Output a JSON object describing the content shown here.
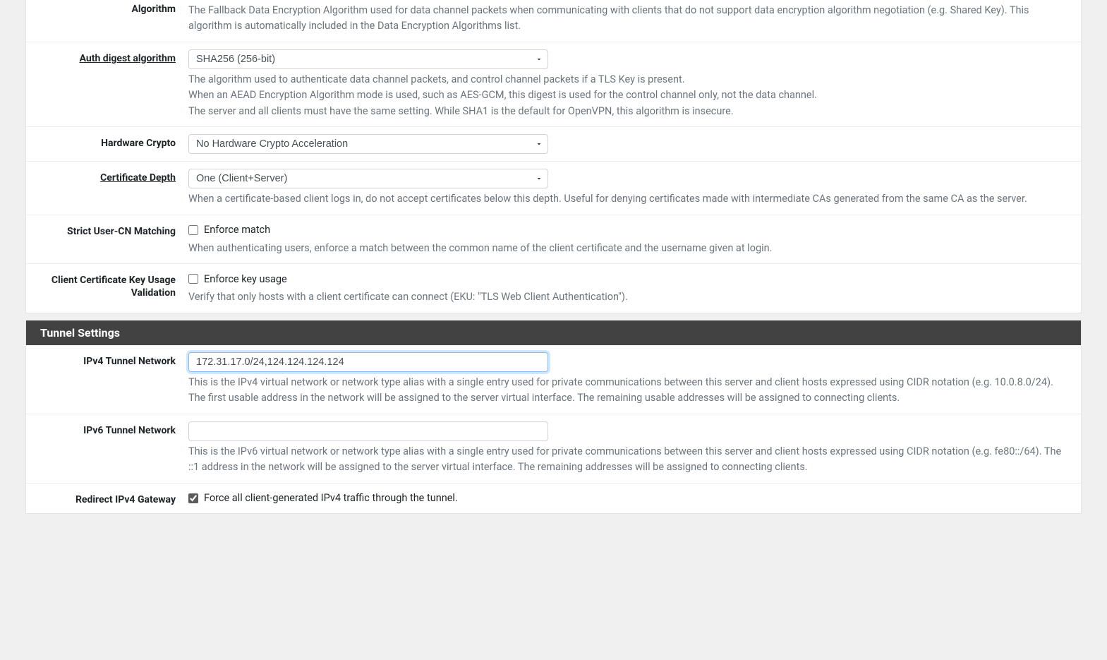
{
  "crypto": {
    "algorithm": {
      "label": "Algorithm",
      "help": "The Fallback Data Encryption Algorithm used for data channel packets when communicating with clients that do not support data encryption algorithm negotiation (e.g. Shared Key). This algorithm is automatically included in the Data Encryption Algorithms list."
    },
    "auth_digest": {
      "label": "Auth digest algorithm",
      "value": "SHA256 (256-bit)",
      "help1": "The algorithm used to authenticate data channel packets, and control channel packets if a TLS Key is present.",
      "help2": "When an AEAD Encryption Algorithm mode is used, such as AES-GCM, this digest is used for the control channel only, not the data channel.",
      "help3": "The server and all clients must have the same setting. While SHA1 is the default for OpenVPN, this algorithm is insecure."
    },
    "hardware": {
      "label": "Hardware Crypto",
      "value": "No Hardware Crypto Acceleration"
    },
    "cert_depth": {
      "label": "Certificate Depth",
      "value": "One (Client+Server)",
      "help": "When a certificate-based client logs in, do not accept certificates below this depth. Useful for denying certificates made with intermediate CAs generated from the same CA as the server."
    },
    "strict_user_cn": {
      "label": "Strict User-CN Matching",
      "chk_label": "Enforce match",
      "help": "When authenticating users, enforce a match between the common name of the client certificate and the username given at login."
    },
    "cckuv": {
      "label": "Client Certificate Key Usage Validation",
      "chk_label": "Enforce key usage",
      "help": "Verify that only hosts with a client certificate can connect (EKU: \"TLS Web Client Authentication\")."
    }
  },
  "tunnel": {
    "heading": "Tunnel Settings",
    "ipv4_net": {
      "label": "IPv4 Tunnel Network",
      "value": "172.31.17.0/24,124.124.124.124",
      "help": "This is the IPv4 virtual network or network type alias with a single entry used for private communications between this server and client hosts expressed using CIDR notation (e.g. 10.0.8.0/24). The first usable address in the network will be assigned to the server virtual interface. The remaining usable addresses will be assigned to connecting clients."
    },
    "ipv6_net": {
      "label": "IPv6 Tunnel Network",
      "value": "",
      "help": "This is the IPv6 virtual network or network type alias with a single entry used for private communications between this server and client hosts expressed using CIDR notation (e.g. fe80::/64). The ::1 address in the network will be assigned to the server virtual interface. The remaining addresses will be assigned to connecting clients."
    },
    "redirect_v4": {
      "label": "Redirect IPv4 Gateway",
      "chk_label": "Force all client-generated IPv4 traffic through the tunnel.",
      "checked": true
    }
  }
}
